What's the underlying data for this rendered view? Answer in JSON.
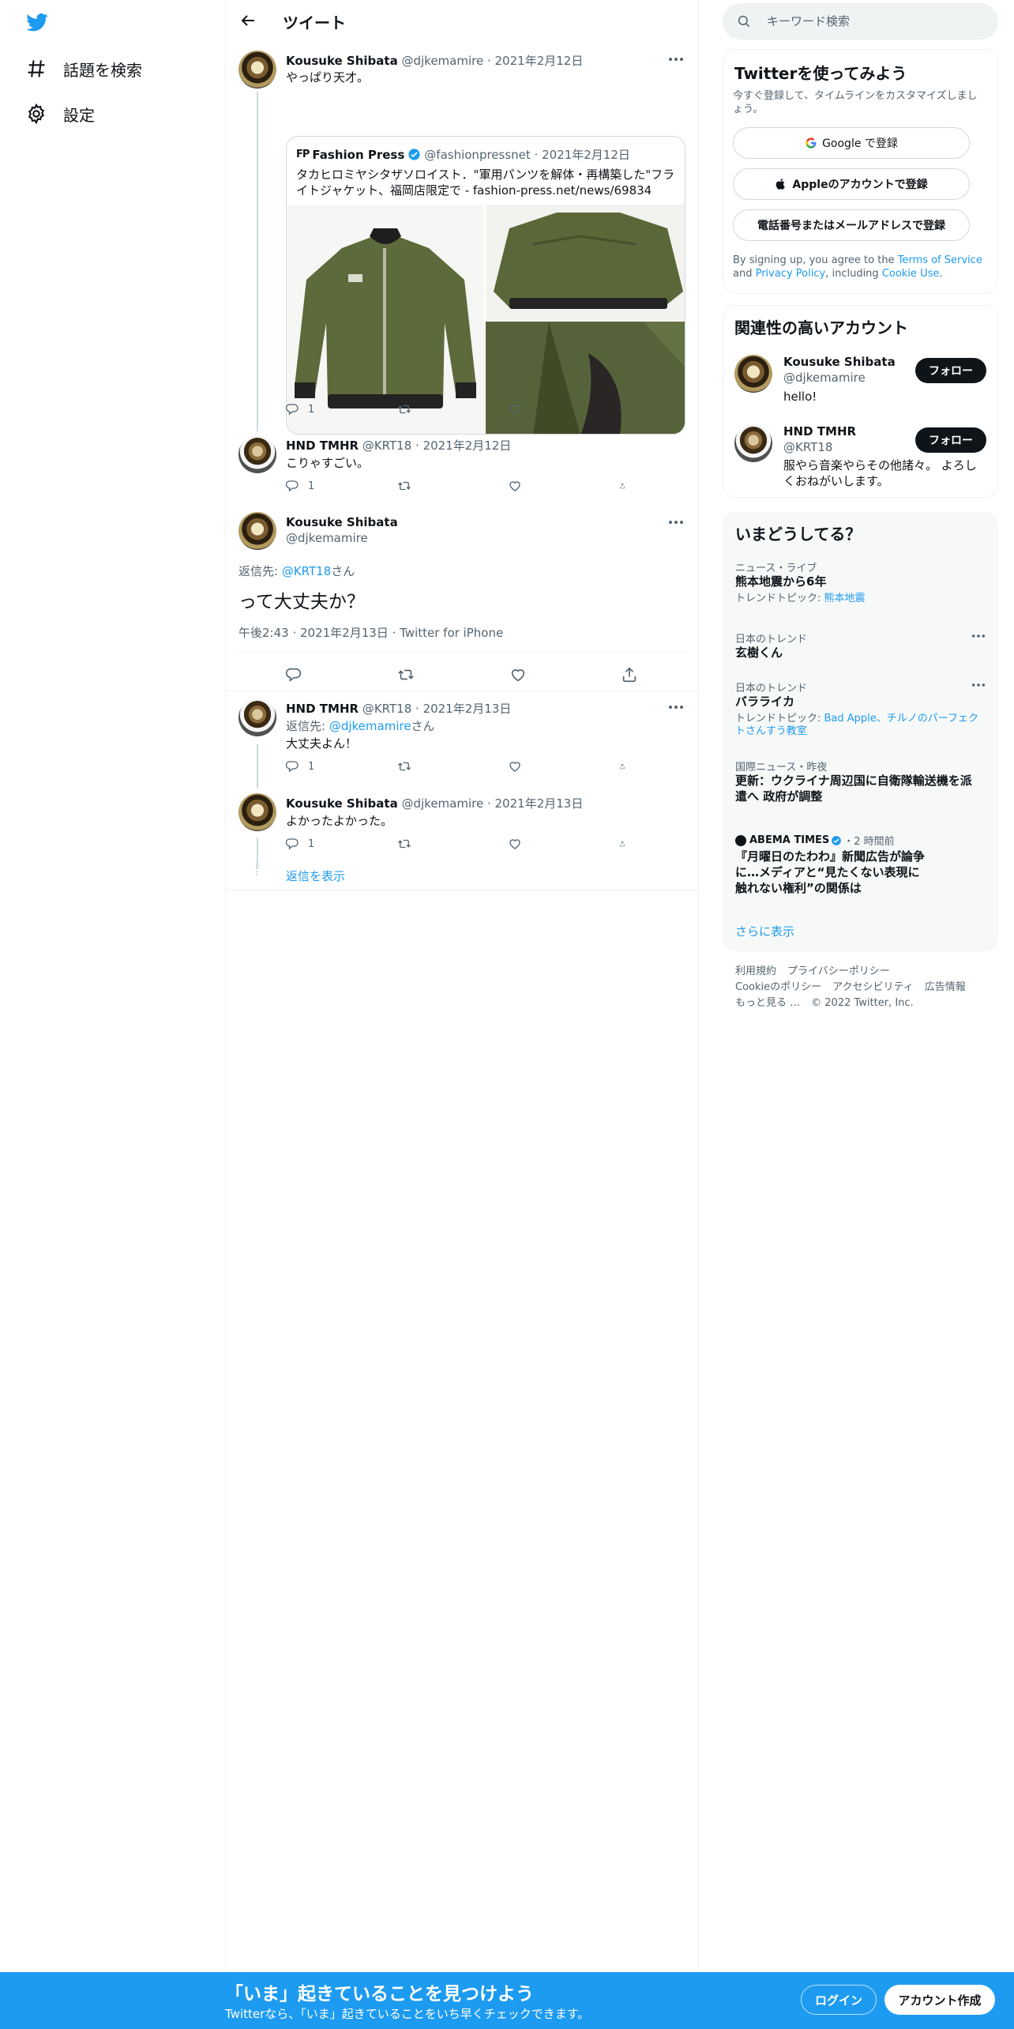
{
  "sidebar": {
    "items": [
      {
        "label": "話題を検索",
        "icon": "hashtag-icon"
      },
      {
        "label": "設定",
        "icon": "gear-icon"
      }
    ]
  },
  "header": {
    "title": "ツイート"
  },
  "tweets": {
    "first": {
      "name": "Kousuke Shibata",
      "handle": "@djkemamire",
      "date": "2021年2月12日",
      "text": "やっぱり天才。",
      "reply_count": "1",
      "quote": {
        "name": "Fashion Press",
        "handle": "@fashionpressnet",
        "date": "2021年2月12日",
        "text": "タカヒロミヤシタザソロイスト．\"軍用パンツを解体・再構築した\"フライトジャケット、福岡店限定で - fashion-press.net/news/69834"
      }
    },
    "second": {
      "name": "HND TMHR",
      "handle": "@KRT18",
      "date": "2021年2月12日",
      "text": "こりゃすごい。",
      "reply_count": "1"
    },
    "main": {
      "name": "Kousuke Shibata",
      "handle": "@djkemamire",
      "reply_prefix": "返信先: ",
      "reply_to": "@KRT18",
      "reply_suffix": "さん",
      "text": "って大丈夫か？",
      "time": "午後2:43",
      "date": "2021年2月13日",
      "client": "Twitter for iPhone"
    },
    "fourth": {
      "name": "HND TMHR",
      "handle": "@KRT18",
      "date": "2021年2月13日",
      "reply_prefix": "返信先: ",
      "reply_to": "@djkemamire",
      "reply_suffix": "さん",
      "text": "大丈夫よん！",
      "reply_count": "1"
    },
    "fifth": {
      "name": "Kousuke Shibata",
      "handle": "@djkemamire",
      "date": "2021年2月13日",
      "text": "よかったよかった。",
      "reply_count": "1"
    },
    "show_replies": "返信を表示"
  },
  "search": {
    "placeholder": "キーワード検索"
  },
  "signup_card": {
    "title": "Twitterを使ってみよう",
    "subtitle": "今すぐ登録して、タイムラインをカスタマイズしましょう。",
    "google": "Google で登録",
    "apple": "Appleのアカウントで登録",
    "phone": "電話番号またはメールアドレスで登録",
    "terms_1": "By signing up, you agree to the ",
    "terms_link": "Terms of Service",
    "terms_2": " and ",
    "privacy_link": "Privacy Policy",
    "terms_3": ", including ",
    "cookie_link": "Cookie Use",
    "terms_4": "."
  },
  "relevant": {
    "title": "関連性の高いアカウント",
    "accounts": [
      {
        "name": "Kousuke Shibata",
        "handle": "@djkemamire",
        "bio": "hello!",
        "button": "フォロー"
      },
      {
        "name": "HND TMHR",
        "handle": "@KRT18",
        "bio": "服やら音楽やらその他諸々。 よろしくおねがいします。",
        "button": "フォロー"
      }
    ]
  },
  "trends": {
    "title": "いまどうしてる？",
    "items": [
      {
        "category": "ニュース・ライブ",
        "name": "熊本地震から6年",
        "sub_prefix": "トレンドトピック: ",
        "sub_link": "熊本地震"
      },
      {
        "category": "日本のトレンド",
        "name": "玄樹くん"
      },
      {
        "category": "日本のトレンド",
        "name": "バラライカ",
        "sub_prefix": "トレンドトピック: ",
        "sub_link": "Bad Apple、チルノのパーフェクトさんすう教室"
      },
      {
        "category": "国際ニュース・昨夜",
        "name": "更新：ウクライナ周辺国に自衛隊輸送機を派遣へ 政府が調整"
      },
      {
        "source": "ABEMA TIMES",
        "ago": "・2 時間前",
        "name": "『月曜日のたわわ』新聞広告が論争に…メディアと“見たくない表現に触れない権利”の関係は"
      }
    ],
    "show_more": "さらに表示"
  },
  "footer": {
    "row1": [
      "利用規約",
      "プライバシーポリシー"
    ],
    "row2": [
      "Cookieのポリシー",
      "アクセシビリティ",
      "広告情報"
    ],
    "row3": [
      "もっと見る …",
      "© 2022 Twitter, Inc."
    ]
  },
  "bottom_bar": {
    "headline": "「いま」起きていることを見つけよう",
    "sub": "Twitterなら、「いま」起きていることをいち早くチェックできます。",
    "login": "ログイン",
    "signup": "アカウント作成"
  },
  "colors": {
    "accent": "#1d9bf0",
    "text": "#0f1419",
    "muted": "#536471",
    "verified": "#1d9bf0"
  }
}
